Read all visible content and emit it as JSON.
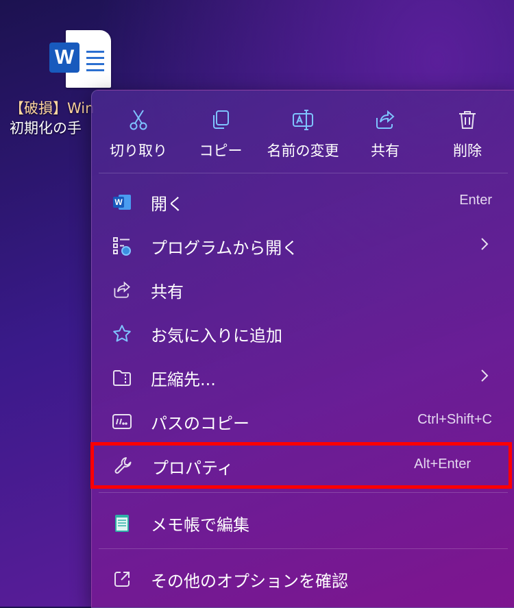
{
  "desktop": {
    "file_icon": "word-document-icon",
    "file_label_line1": "【破損】Win",
    "file_label_line2": "初期化の手"
  },
  "context_menu": {
    "toolbar": [
      {
        "label": "切り取り",
        "icon": "scissors-icon"
      },
      {
        "label": "コピー",
        "icon": "copy-icon"
      },
      {
        "label": "名前の変更",
        "icon": "rename-icon"
      },
      {
        "label": "共有",
        "icon": "share-icon"
      },
      {
        "label": "削除",
        "icon": "trash-icon"
      }
    ],
    "items": [
      {
        "label": "開く",
        "shortcut": "Enter",
        "icon": "word-app-icon"
      },
      {
        "label": "プログラムから開く",
        "icon": "open-with-icon",
        "submenu": true
      },
      {
        "label": "共有",
        "icon": "share-icon"
      },
      {
        "label": "お気に入りに追加",
        "icon": "star-icon"
      },
      {
        "label": "圧縮先...",
        "icon": "zip-folder-icon",
        "submenu": true
      },
      {
        "label": "パスのコピー",
        "shortcut": "Ctrl+Shift+C",
        "icon": "copy-path-icon"
      },
      {
        "label": "プロパティ",
        "shortcut": "Alt+Enter",
        "icon": "wrench-icon",
        "highlighted": true
      },
      {
        "label": "メモ帳で編集",
        "icon": "notepad-icon"
      },
      {
        "label": "その他のオプションを確認",
        "icon": "external-link-icon"
      }
    ],
    "chevron_glyph": "›"
  },
  "colors": {
    "highlight_border": "#ff0000",
    "icon_accent": "#7fc4ff"
  }
}
